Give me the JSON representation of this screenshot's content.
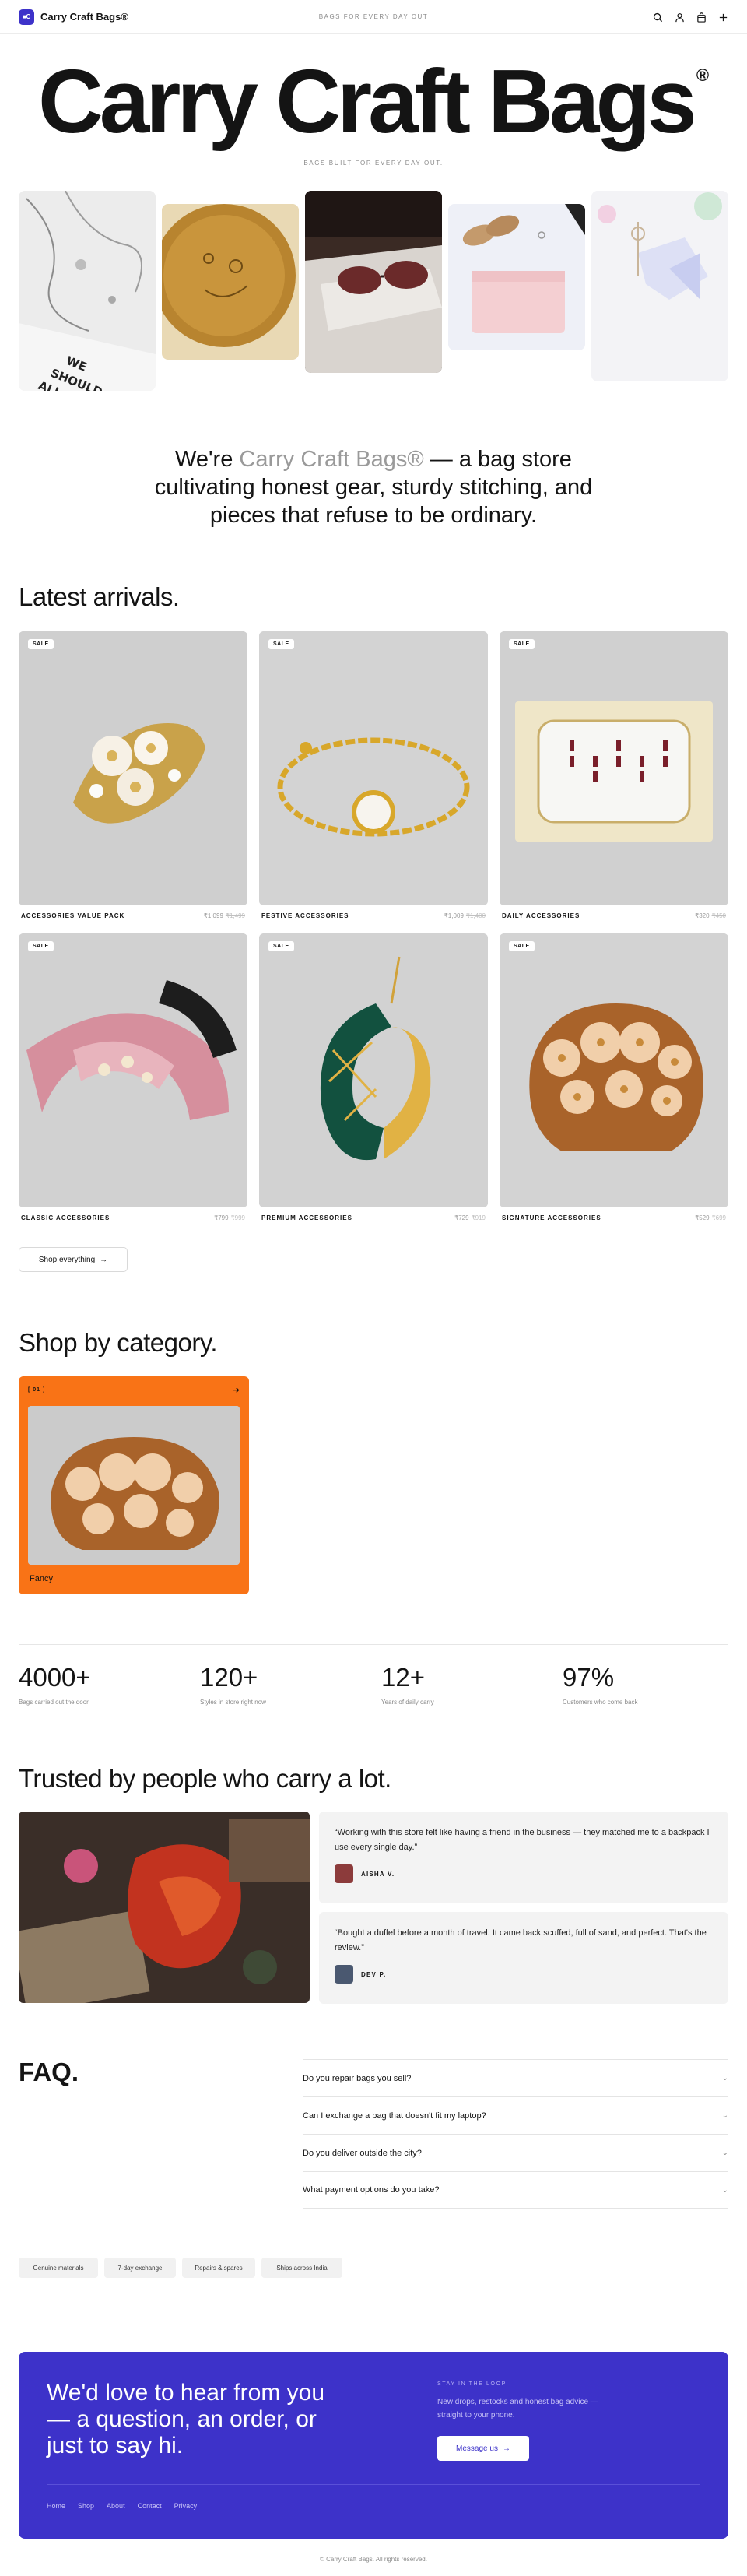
{
  "header": {
    "logo_mark": "■C",
    "brand": "Carry Craft Bags®",
    "tagline": "BAGS FOR EVERY DAY OUT",
    "icons": [
      "search-icon",
      "user-icon",
      "bag-icon",
      "plus-icon"
    ]
  },
  "hero": {
    "title": "Carry Craft Bags",
    "mark": "®",
    "tagline": "BAGS BUILT FOR EVERY DAY OUT."
  },
  "intro": {
    "lead": "We're ",
    "accent": "Carry Craft Bags®",
    "rest": " — a bag store cultivating honest gear, sturdy stitching, and pieces that refuse to be ordinary."
  },
  "latest": {
    "title": "Latest arrivals.",
    "sale_label": "SALE",
    "products": [
      {
        "category": "ACCESSORIES VALUE PACK",
        "price": "₹1,099",
        "old_price": "₹1,499"
      },
      {
        "category": "FESTIVE ACCESSORIES",
        "price": "₹1,009",
        "old_price": "₹1,400"
      },
      {
        "category": "DAILY ACCESSORIES",
        "price": "₹320",
        "old_price": "₹450"
      },
      {
        "category": "CLASSIC ACCESSORIES",
        "price": "₹799",
        "old_price": "₹999"
      },
      {
        "category": "PREMIUM ACCESSORIES",
        "price": "₹729",
        "old_price": "₹919"
      },
      {
        "category": "SIGNATURE ACCESSORIES",
        "price": "₹529",
        "old_price": "₹699"
      }
    ],
    "shop_button": "Shop everything"
  },
  "category": {
    "title": "Shop by category.",
    "card": {
      "index": "[ 01 ]",
      "name": "Fancy"
    }
  },
  "stats": [
    {
      "value": "4000+",
      "label": "Bags carried out the door"
    },
    {
      "value": "120+",
      "label": "Styles in store right now"
    },
    {
      "value": "12+",
      "label": "Years of daily carry"
    },
    {
      "value": "97%",
      "label": "Customers who come back"
    }
  ],
  "testimonials": {
    "title": "Trusted by people who carry a lot.",
    "items": [
      {
        "quote": "“Working with this store felt like having a friend in the business — they matched me to a backpack I use every single day.”",
        "name": "AISHA V."
      },
      {
        "quote": "“Bought a duffel before a month of travel. It came back scuffed, full of sand, and perfect. That's the review.”",
        "name": "DEV P."
      }
    ]
  },
  "faq": {
    "title": "FAQ.",
    "items": [
      "Do you repair bags you sell?",
      "Can I exchange a bag that doesn't fit my laptop?",
      "Do you deliver outside the city?",
      "What payment options do you take?"
    ]
  },
  "chips": [
    "Genuine materials",
    "7-day exchange",
    "Repairs & spares",
    "Ships across India"
  ],
  "cta": {
    "heading": "We'd love to hear from you — a question, an order, or just to say hi.",
    "eyebrow": "STAY IN THE LOOP",
    "desc": "New drops, restocks and honest bag advice — straight to your phone.",
    "button": "Message us",
    "links": [
      "Home",
      "Shop",
      "About",
      "Contact",
      "Privacy"
    ]
  },
  "footer": {
    "copyright": "© Carry Craft Bags. All rights reserved."
  },
  "colors": {
    "accent": "#3d32c9",
    "category_card": "#f97316"
  }
}
